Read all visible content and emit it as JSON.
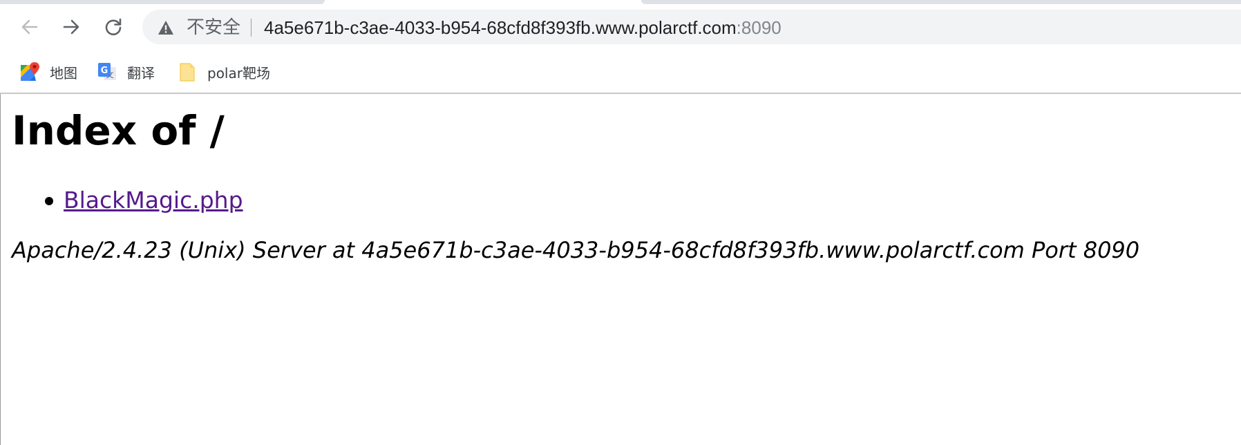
{
  "browser": {
    "security_label": "不安全",
    "url_host": "4a5e671b-c3ae-4033-b954-68cfd8f393fb.www.polarctf.com",
    "url_port": ":8090",
    "back_icon": "back-arrow-icon",
    "forward_icon": "forward-arrow-icon",
    "reload_icon": "reload-icon",
    "security_icon": "warning-triangle-icon"
  },
  "bookmarks": [
    {
      "label": "地图",
      "icon": "google-maps-icon"
    },
    {
      "label": "翻译",
      "icon": "google-translate-icon"
    },
    {
      "label": "polar靶场",
      "icon": "folder-icon"
    }
  ],
  "page": {
    "heading": "Index of /",
    "files": [
      {
        "name": "BlackMagic.php"
      }
    ],
    "server_signature": "Apache/2.4.23 (Unix) Server at 4a5e671b-c3ae-4033-b954-68cfd8f393fb.www.polarctf.com Port 8090"
  },
  "colors": {
    "visited_link": "#551a8b",
    "omnibox_bg": "#f1f3f4"
  }
}
